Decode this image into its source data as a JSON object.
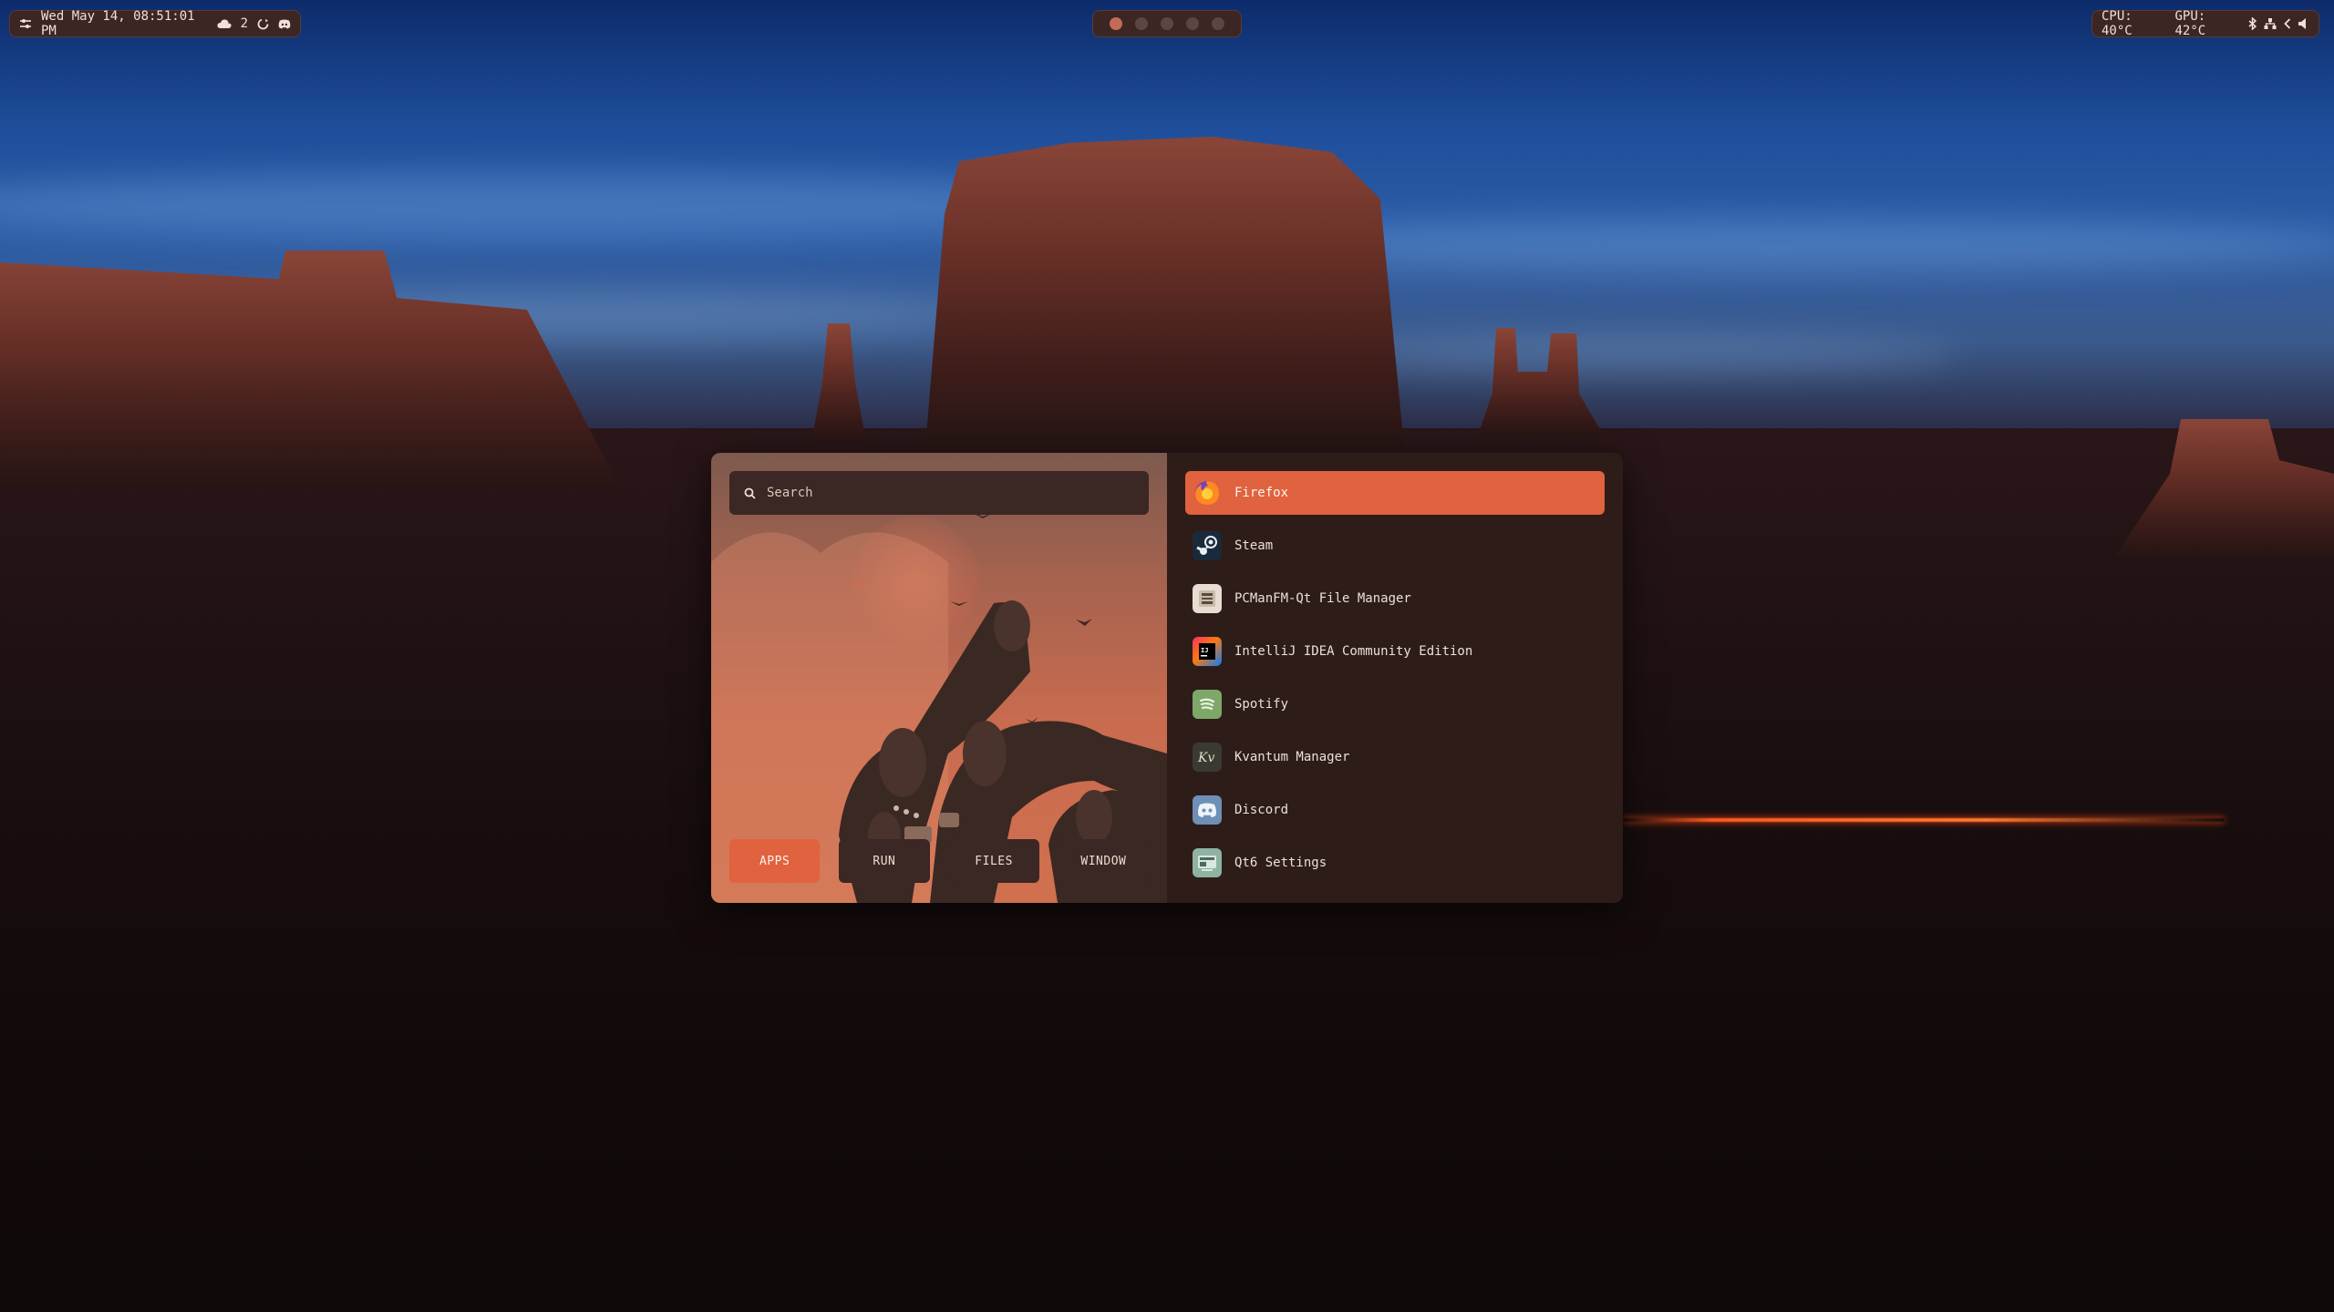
{
  "topbar": {
    "datetime": "Wed May 14, 08:51:01 PM",
    "cloud_count": "2",
    "workspace_count": 5,
    "active_workspace": 1,
    "cpu_temp": "CPU: 40°C",
    "gpu_temp": "GPU: 42°C"
  },
  "launcher": {
    "search_placeholder": "Search",
    "modes": [
      {
        "label": "APPS",
        "active": true
      },
      {
        "label": "RUN",
        "active": false
      },
      {
        "label": "FILES",
        "active": false
      },
      {
        "label": "WINDOW",
        "active": false
      }
    ],
    "apps": [
      {
        "label": "Firefox",
        "icon": "firefox-icon",
        "selected": true
      },
      {
        "label": "Steam",
        "icon": "steam-icon",
        "selected": false
      },
      {
        "label": "PCManFM-Qt File Manager",
        "icon": "file-manager-icon",
        "selected": false
      },
      {
        "label": "IntelliJ IDEA Community Edition",
        "icon": "intellij-icon",
        "selected": false
      },
      {
        "label": "Spotify",
        "icon": "spotify-icon",
        "selected": false
      },
      {
        "label": "Kvantum Manager",
        "icon": "kvantum-icon",
        "selected": false
      },
      {
        "label": "Discord",
        "icon": "discord-icon",
        "selected": false
      },
      {
        "label": "Qt6 Settings",
        "icon": "qt-settings-icon",
        "selected": false
      }
    ]
  },
  "colors": {
    "accent": "#e0623f",
    "panel_dark": "#2e1c19",
    "pill_bg": "#3c2623"
  }
}
